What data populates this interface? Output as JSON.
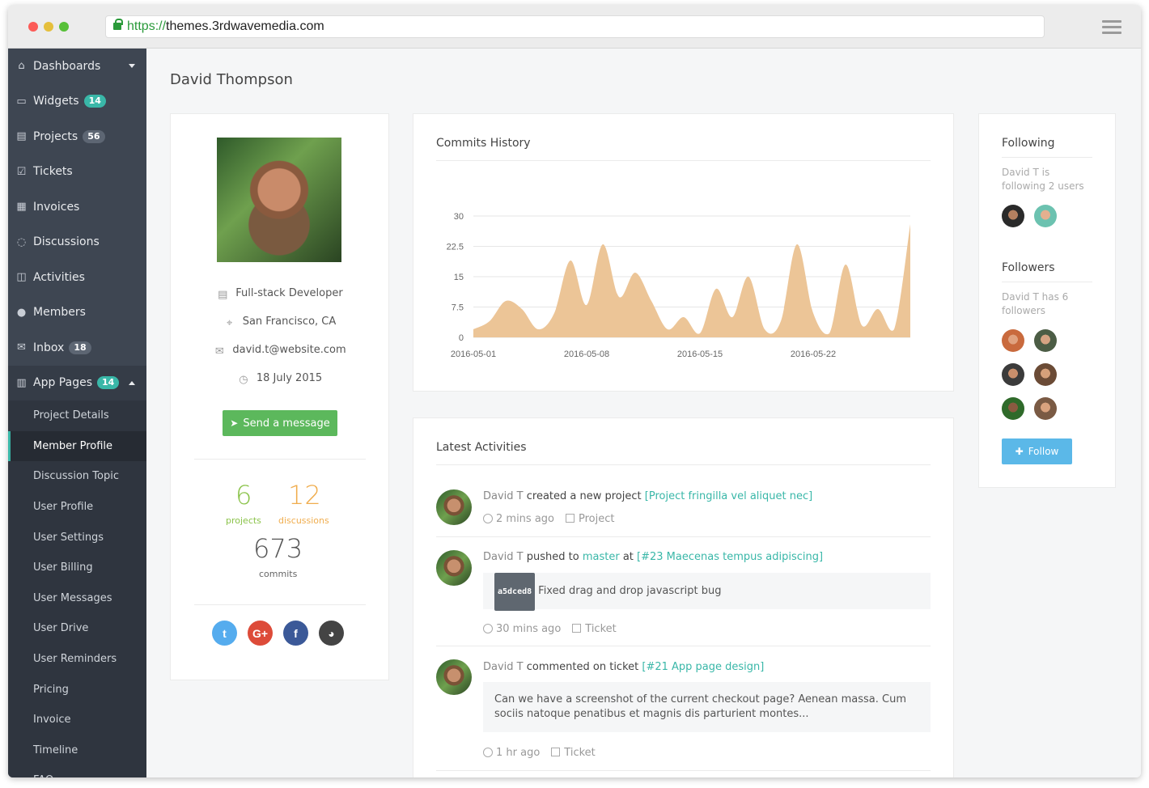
{
  "browser": {
    "url_protocol": "https://",
    "url_host": "themes.3rdwavemedia.com"
  },
  "sidebar": {
    "items": [
      {
        "label": "Dashboards",
        "icon": "home-icon",
        "badge": ""
      },
      {
        "label": "Widgets",
        "icon": "inbox-tray-icon",
        "badge": "14"
      },
      {
        "label": "Projects",
        "icon": "briefcase-icon",
        "badge": "56"
      },
      {
        "label": "Tickets",
        "icon": "checkbox-icon",
        "badge": ""
      },
      {
        "label": "Invoices",
        "icon": "document-icon",
        "badge": ""
      },
      {
        "label": "Discussions",
        "icon": "chat-bubble-icon",
        "badge": ""
      },
      {
        "label": "Activities",
        "icon": "presentation-icon",
        "badge": ""
      },
      {
        "label": "Members",
        "icon": "users-icon",
        "badge": ""
      },
      {
        "label": "Inbox",
        "icon": "envelope-icon",
        "badge": "18"
      },
      {
        "label": "App Pages",
        "icon": "building-icon",
        "badge": "14"
      }
    ],
    "sub_items": [
      "Project Details",
      "Member Profile",
      "Discussion Topic",
      "User Profile",
      "User Settings",
      "User Billing",
      "User Messages",
      "User Drive",
      "User Reminders",
      "Pricing",
      "Invoice",
      "Timeline",
      "FAQ"
    ],
    "active_sub_item": "Member Profile"
  },
  "page": {
    "title": "David Thompson"
  },
  "profile": {
    "role": "Full-stack Developer",
    "location": "San Francisco, CA",
    "email": "david.t@website.com",
    "joined": "18 July 2015",
    "send_message_label": "Send a message",
    "stats": {
      "projects_value": "6",
      "projects_label": "projects",
      "discussions_value": "12",
      "discussions_label": "discussions",
      "commits_value": "673",
      "commits_label": "commits"
    },
    "social": [
      "twitter-icon",
      "google-plus-icon",
      "facebook-icon",
      "github-icon"
    ]
  },
  "commits_card": {
    "title": "Commits History"
  },
  "chart_data": {
    "type": "area",
    "title": "Commits History",
    "x": [
      "2016-05-01",
      "2016-05-02",
      "2016-05-03",
      "2016-05-04",
      "2016-05-05",
      "2016-05-06",
      "2016-05-07",
      "2016-05-08",
      "2016-05-09",
      "2016-05-10",
      "2016-05-11",
      "2016-05-12",
      "2016-05-13",
      "2016-05-14",
      "2016-05-15",
      "2016-05-16",
      "2016-05-17",
      "2016-05-18",
      "2016-05-19",
      "2016-05-20",
      "2016-05-21",
      "2016-05-22",
      "2016-05-23",
      "2016-05-24",
      "2016-05-25",
      "2016-05-26",
      "2016-05-27",
      "2016-05-28"
    ],
    "x_ticks": [
      "2016-05-01",
      "2016-05-08",
      "2016-05-15",
      "2016-05-22"
    ],
    "values": [
      2,
      4,
      9,
      7,
      2,
      6,
      19,
      8,
      23,
      10,
      16,
      9,
      2,
      5,
      1,
      12,
      5,
      15,
      2,
      4,
      23,
      6,
      1,
      18,
      3,
      7,
      2,
      28
    ],
    "y_ticks": [
      "0",
      "7.5",
      "15",
      "22.5",
      "30"
    ],
    "ylim": [
      0,
      30
    ],
    "color": "#ecc597",
    "grid": true
  },
  "activities": {
    "title": "Latest Activities",
    "items": [
      {
        "who": "David T",
        "action": "created a new project",
        "link": "[Project fringilla vel aliquet nec]",
        "time": "2 mins ago",
        "tag": "Project"
      },
      {
        "who": "David T",
        "action": "pushed to",
        "branch": "master",
        "at": "at",
        "link": "[#23 Maecenas tempus adipiscing]",
        "hash": "a5dced8",
        "message": "Fixed drag and drop javascript bug",
        "time": "30 mins ago",
        "tag": "Ticket"
      },
      {
        "who": "David T",
        "action": "commented on ticket",
        "link": "[#21 App page design]",
        "comment": "Can we have a screenshot of the current checkout page? Aenean massa. Cum sociis natoque penatibus et magnis dis parturient montes...",
        "time": "1 hr ago",
        "tag": "Ticket"
      }
    ]
  },
  "following": {
    "title": "Following",
    "text": "David T is following 2 users"
  },
  "followers": {
    "title": "Followers",
    "text": "David T has 6 followers",
    "follow_label": "Follow"
  }
}
